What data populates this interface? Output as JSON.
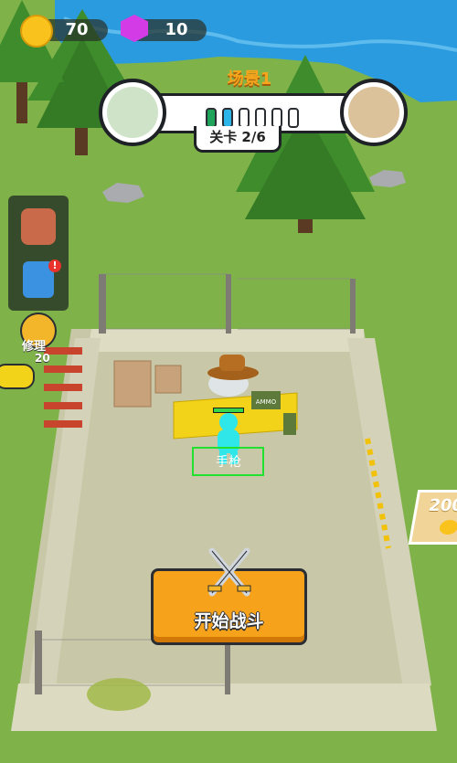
{
  "hud": {
    "coins": "70",
    "gems": "10"
  },
  "level": {
    "scene_title": "场景1",
    "stage_label": "关卡 2/6",
    "current_stage": 2,
    "total_stages": 6
  },
  "repair": {
    "label": "修理",
    "cost": "20"
  },
  "player": {
    "name_tag": "手枪"
  },
  "desk": {
    "ammo_label": "AMMO"
  },
  "price_tag": {
    "value": "200"
  },
  "start_button": {
    "label": "开始战斗"
  },
  "colors": {
    "accent": "#f6a21a",
    "player": "#2fe6e8",
    "floor": "#c8c7a8",
    "grass": "#7fb34a",
    "river": "#2b9be0"
  }
}
